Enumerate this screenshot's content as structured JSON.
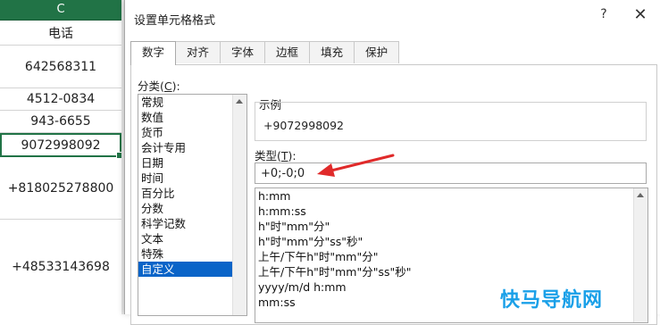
{
  "sheet": {
    "column_header": "C",
    "header_cell": "电话",
    "cells": [
      "642568311",
      "4512-0834",
      "943-6655",
      "9072998092",
      "+818025278800",
      "+48533143698"
    ]
  },
  "dialog": {
    "title": "设置单元格格式",
    "help": "?",
    "close": "✕",
    "tabs": [
      "数字",
      "对齐",
      "字体",
      "边框",
      "填充",
      "保护"
    ],
    "active_tab": "数字",
    "category_label": "分类(",
    "category_key": "C",
    "category_label_end": "):",
    "categories": [
      "常规",
      "数值",
      "货币",
      "会计专用",
      "日期",
      "时间",
      "百分比",
      "分数",
      "科学记数",
      "文本",
      "特殊",
      "自定义"
    ],
    "selected_category": "自定义",
    "sample_label": "示例",
    "sample_value": "+9072998092",
    "type_label": "类型(",
    "type_key": "T",
    "type_label_end": "):",
    "type_value": "+0;-0;0",
    "formats": [
      "h:mm",
      "h:mm:ss",
      "h\"时\"mm\"分\"",
      "h\"时\"mm\"分\"ss\"秒\"",
      "上午/下午h\"时\"mm\"分\"",
      "上午/下午h\"时\"mm\"分\"ss\"秒\"",
      "yyyy/m/d h:mm",
      "mm:ss"
    ]
  },
  "watermark": "快马导航网",
  "colors": {
    "excel_green": "#217346",
    "selection_blue": "#0a64c8",
    "arrow_red": "#e02a2a"
  }
}
